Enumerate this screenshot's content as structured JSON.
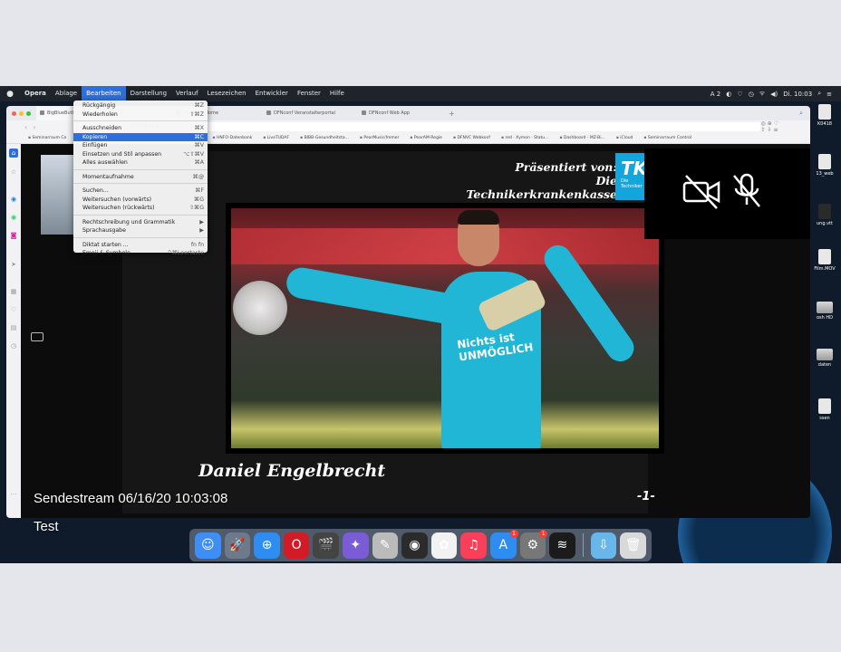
{
  "menubar": {
    "app": "Opera",
    "items": [
      "Ablage",
      "Bearbeiten",
      "Darstellung",
      "Verlauf",
      "Lesezeichen",
      "Entwickler",
      "Fenster",
      "Hilfe"
    ],
    "active": "Bearbeiten",
    "status_icons": [
      "A 2",
      "◐",
      "♡",
      "◷",
      "ᯤ",
      "◀)"
    ],
    "clock": "Di. 10:03"
  },
  "desktop_icons": [
    {
      "label": "K0418"
    },
    {
      "label": "13_web"
    },
    {
      "label": "ung.vtt"
    },
    {
      "label": "Film.MOV"
    },
    {
      "label": "osh HD"
    },
    {
      "label": "daten"
    },
    {
      "label": "ssen"
    }
  ],
  "browser": {
    "tabs": [
      "BigBlueButton - Co",
      "DFNconf: Home",
      "DFNconf Veranstalterportal",
      "DFNconf Web App"
    ],
    "url": "97966918",
    "bookmarks": [
      "Seminarraum Co",
      "kassa",
      "HNFO-Datenbank",
      "LiveTUDAF",
      "BIBB-Gesundheitsta...",
      "PearMusic/Immer",
      "PearAM-Regie",
      "DFNVC Webkonf",
      "red · Xymon · Statu...",
      "Dashboard - MZ-Bi...",
      "iCloud",
      "Seminarraum Control"
    ]
  },
  "edit_menu": {
    "groups": [
      [
        {
          "label": "Rückgängig",
          "shortcut": "⌘Z"
        },
        {
          "label": "Wiederholen",
          "shortcut": "⇧⌘Z"
        }
      ],
      [
        {
          "label": "Ausschneiden",
          "shortcut": "⌘X"
        },
        {
          "label": "Kopieren",
          "shortcut": "⌘C"
        },
        {
          "label": "Einfügen",
          "shortcut": "⌘V"
        },
        {
          "label": "Einsetzen und Stil anpassen",
          "shortcut": "⌥⇧⌘V"
        },
        {
          "label": "Alles auswählen",
          "shortcut": "⌘A"
        }
      ],
      [
        {
          "label": "Momentaufnahme",
          "shortcut": "⌘@"
        }
      ],
      [
        {
          "label": "Suchen...",
          "shortcut": "⌘F"
        },
        {
          "label": "Weitersuchen (vorwärts)",
          "shortcut": "⌘G"
        },
        {
          "label": "Weitersuchen (rückwärts)",
          "shortcut": "⇧⌘G"
        }
      ],
      [
        {
          "label": "Rechtschreibung und Grammatik",
          "shortcut": "▶"
        },
        {
          "label": "Sprachausgabe",
          "shortcut": "▶"
        }
      ],
      [
        {
          "label": "Diktat starten ...",
          "shortcut": "fn fn"
        },
        {
          "label": "Emoji & Symbole",
          "shortcut": "^⌘Leertaste"
        }
      ]
    ],
    "highlighted": "Kopieren"
  },
  "slide": {
    "credit_line1": "Präsentiert von:",
    "credit_line2": "Die Technikerkrankenkasse",
    "logo_mark": "TK",
    "logo_line1": "Die",
    "logo_line2": "Techniker",
    "shirt_line1": "Nichts ist",
    "shirt_line2": "UNMÖGLICH",
    "name": "Daniel Engelbrecht",
    "page": "-1-"
  },
  "overlay": {
    "stream": "Sendestream 06/16/20 10:03:08",
    "test": "Test"
  },
  "dock": {
    "apps": [
      {
        "name": "finder",
        "color": "#3e8ef7",
        "glyph": "☺"
      },
      {
        "name": "launchpad",
        "color": "#6c7a8c",
        "glyph": "🚀"
      },
      {
        "name": "safari",
        "color": "#2f8cf0",
        "glyph": "⊕"
      },
      {
        "name": "opera",
        "color": "#d31b27",
        "glyph": "O"
      },
      {
        "name": "final-cut",
        "color": "#444",
        "glyph": "🎬"
      },
      {
        "name": "app-6",
        "color": "#7b5cd6",
        "glyph": "✦"
      },
      {
        "name": "app-7",
        "color": "#bbb",
        "glyph": "✎"
      },
      {
        "name": "app-8",
        "color": "#2b2b2b",
        "glyph": "◉"
      },
      {
        "name": "photos",
        "color": "#f2f2f2",
        "glyph": "✿"
      },
      {
        "name": "music",
        "color": "#fa3f5a",
        "glyph": "♫"
      },
      {
        "name": "app-store",
        "color": "#2f8cf0",
        "glyph": "A",
        "badge": "1"
      },
      {
        "name": "system-preferences",
        "color": "#777",
        "glyph": "⚙",
        "badge": "1"
      },
      {
        "name": "activity-monitor",
        "color": "#1b1b1b",
        "glyph": "≋"
      },
      {
        "name": "downloads-folder",
        "color": "#69b6ea",
        "glyph": "⇩"
      },
      {
        "name": "trash",
        "color": "#d9d9d9",
        "glyph": "🗑"
      }
    ]
  }
}
